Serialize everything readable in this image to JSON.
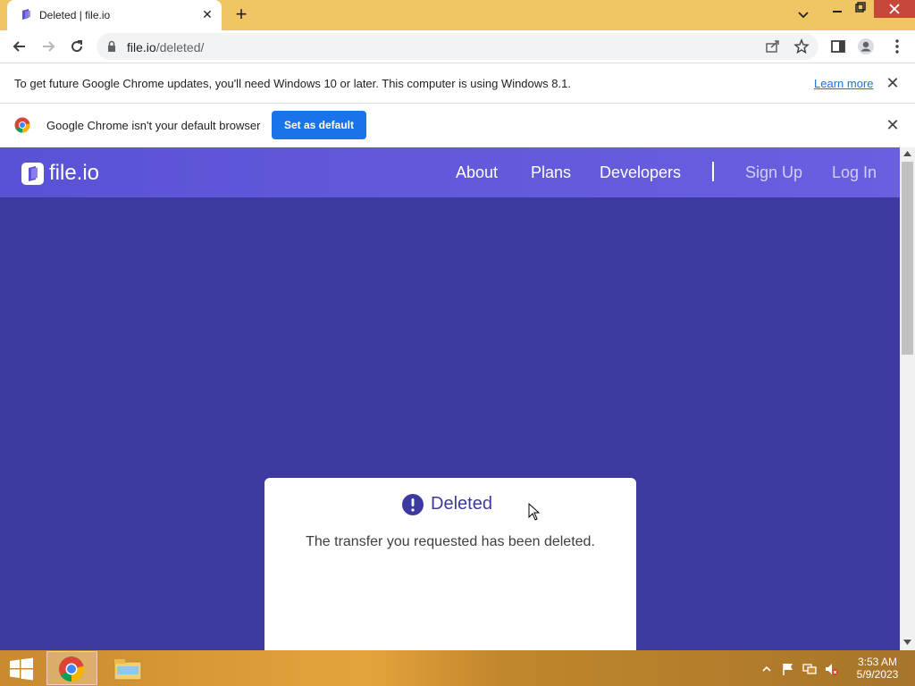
{
  "browser": {
    "tab": {
      "title": "Deleted | file.io",
      "favicon": "file-io-favicon"
    },
    "new_tab_icon": "plus-icon",
    "address": {
      "host": "file.io",
      "path": "/deleted/"
    }
  },
  "infobar_update": {
    "message": "To get future Google Chrome updates, you'll need Windows 10 or later. This computer is using Windows 8.1.",
    "link_label": "Learn more"
  },
  "infobar_default": {
    "message": "Google Chrome isn't your default browser",
    "button_label": "Set as default"
  },
  "site": {
    "logo_text": "file.io",
    "nav": {
      "about": "About",
      "plans": "Plans",
      "developers": "Developers",
      "sign_up": "Sign Up",
      "log_in": "Log In"
    },
    "card": {
      "title": "Deleted",
      "message": "The transfer you requested has been deleted."
    }
  },
  "taskbar": {
    "time": "3:53 AM",
    "date": "5/9/2023"
  },
  "colors": {
    "page_background": "#3d3a9f",
    "header_gradient": "#5a52d5",
    "accent_blue": "#1a73e8",
    "titlebar": "#f0c664",
    "window_close": "#c7483a"
  }
}
